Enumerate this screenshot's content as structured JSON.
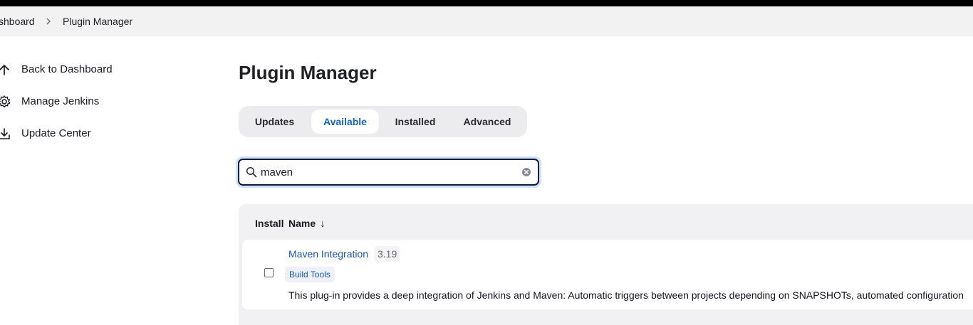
{
  "breadcrumb": {
    "items": [
      "shboard",
      "Plugin Manager"
    ]
  },
  "sidebar": {
    "items": [
      {
        "label": "Back to Dashboard",
        "icon": "arrow-up-icon"
      },
      {
        "label": "Manage Jenkins",
        "icon": "gear-icon"
      },
      {
        "label": "Update Center",
        "icon": "download-icon"
      }
    ]
  },
  "main": {
    "title": "Plugin Manager",
    "tabs": [
      {
        "label": "Updates",
        "active": false
      },
      {
        "label": "Available",
        "active": true
      },
      {
        "label": "Installed",
        "active": false
      },
      {
        "label": "Advanced",
        "active": false
      }
    ],
    "search": {
      "value": "maven",
      "icon": "search-icon",
      "clear_icon": "clear-icon"
    },
    "table": {
      "columns": [
        "Install",
        "Name"
      ],
      "sort_indicator": "↓",
      "rows": [
        {
          "name": "Maven Integration",
          "version": "3.19",
          "tag": "Build Tools",
          "installed_checked": false,
          "excerpt": "This plug-in provides a deep integration of Jenkins and Maven: Automatic triggers between projects depending on SNAPSHOTs, automated configuration"
        }
      ]
    }
  },
  "colors": {
    "accent": "#1565c0",
    "link": "#1a55c0",
    "topbar": "#000000",
    "breadcrumb_bg": "#f2f2f3"
  }
}
